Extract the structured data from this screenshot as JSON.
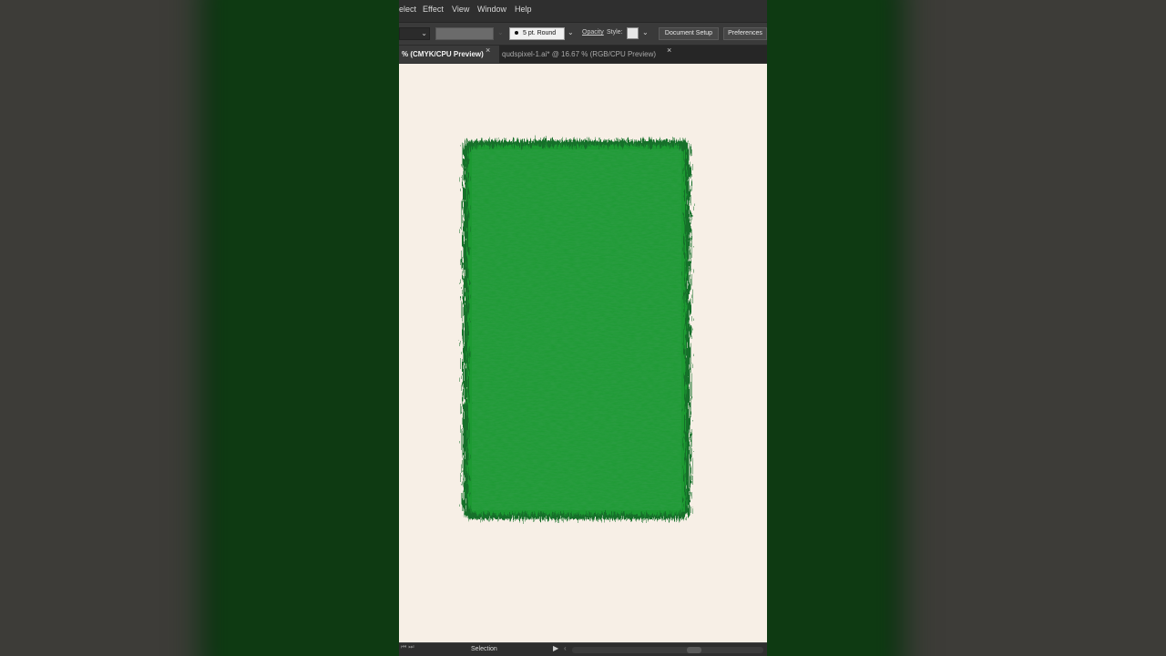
{
  "menubar": {
    "items": [
      "elect",
      "Effect",
      "View",
      "Window",
      "Help"
    ]
  },
  "controlbar": {
    "brush_label": "5 pt. Round",
    "opacity_label": "Opacity",
    "style_label": "Style:",
    "document_setup_label": "Document Setup",
    "preferences_label": "Preferences"
  },
  "tabs": [
    {
      "label": "% (CMYK/CPU Preview)",
      "active": true,
      "close": "×"
    },
    {
      "label": "qudspixel-1.ai* @ 16.67 % (RGB/CPU Preview)",
      "active": false,
      "close": "×"
    }
  ],
  "statusbar": {
    "nav": "⏮ ⏭",
    "tool": "Selection",
    "arrow_right": "▶",
    "arrow_left": "‹"
  },
  "colors": {
    "canvas_bg": "#f7efe6",
    "grass_fill": "#1e9a33",
    "grass_dark": "#12702a",
    "ui_dark": "#323232"
  },
  "icons": {
    "chevron": "chevron-down-icon",
    "close": "close-icon"
  }
}
